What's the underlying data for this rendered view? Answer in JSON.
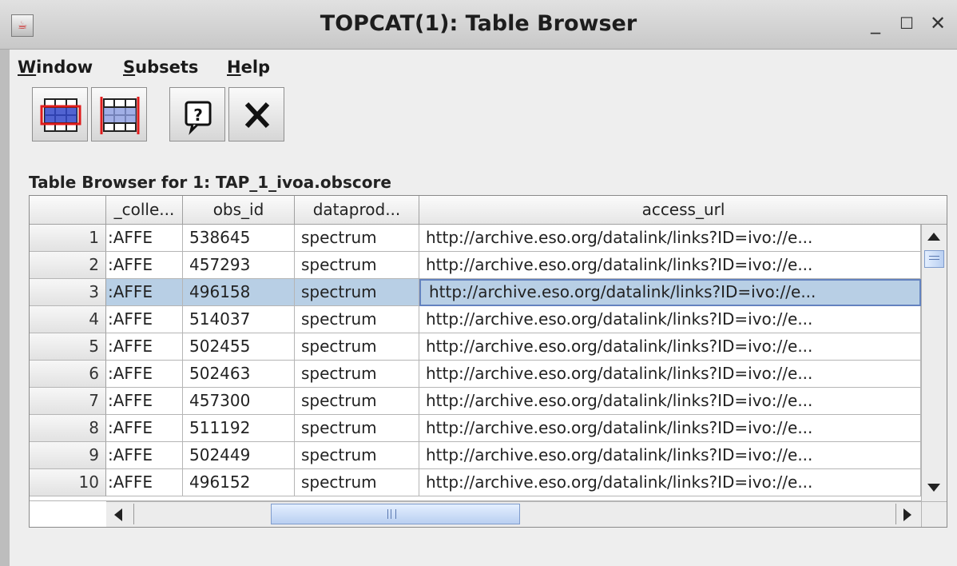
{
  "window": {
    "title": "TOPCAT(1): Table Browser"
  },
  "menubar": {
    "items": [
      {
        "label_pre": "",
        "label_key": "W",
        "label_post": "indow"
      },
      {
        "label_pre": "",
        "label_key": "S",
        "label_post": "ubsets"
      },
      {
        "label_pre": "",
        "label_key": "H",
        "label_post": "elp"
      }
    ]
  },
  "toolbar": {
    "icons": [
      "highlight-row-icon",
      "highlight-column-icon",
      "help-icon",
      "close-icon"
    ]
  },
  "browser": {
    "label": "Table Browser for 1: TAP_1_ivoa.obscore"
  },
  "table": {
    "columns": [
      "_colle...",
      "obs_id",
      "dataprod...",
      "access_url"
    ],
    "rows": [
      {
        "index": "1",
        "collection": ":AFFE",
        "obs_id": "538645",
        "dataproduct": "spectrum",
        "access_url": "http://archive.eso.org/datalink/links?ID=ivo://e..."
      },
      {
        "index": "2",
        "collection": ":AFFE",
        "obs_id": "457293",
        "dataproduct": "spectrum",
        "access_url": "http://archive.eso.org/datalink/links?ID=ivo://e..."
      },
      {
        "index": "3",
        "collection": ":AFFE",
        "obs_id": "496158",
        "dataproduct": "spectrum",
        "access_url": "http://archive.eso.org/datalink/links?ID=ivo://e..."
      },
      {
        "index": "4",
        "collection": ":AFFE",
        "obs_id": "514037",
        "dataproduct": "spectrum",
        "access_url": "http://archive.eso.org/datalink/links?ID=ivo://e..."
      },
      {
        "index": "5",
        "collection": ":AFFE",
        "obs_id": "502455",
        "dataproduct": "spectrum",
        "access_url": "http://archive.eso.org/datalink/links?ID=ivo://e..."
      },
      {
        "index": "6",
        "collection": ":AFFE",
        "obs_id": "502463",
        "dataproduct": "spectrum",
        "access_url": "http://archive.eso.org/datalink/links?ID=ivo://e..."
      },
      {
        "index": "7",
        "collection": ":AFFE",
        "obs_id": "457300",
        "dataproduct": "spectrum",
        "access_url": "http://archive.eso.org/datalink/links?ID=ivo://e..."
      },
      {
        "index": "8",
        "collection": ":AFFE",
        "obs_id": "511192",
        "dataproduct": "spectrum",
        "access_url": "http://archive.eso.org/datalink/links?ID=ivo://e..."
      },
      {
        "index": "9",
        "collection": ":AFFE",
        "obs_id": "502449",
        "dataproduct": "spectrum",
        "access_url": "http://archive.eso.org/datalink/links?ID=ivo://e..."
      },
      {
        "index": "10",
        "collection": ":AFFE",
        "obs_id": "496152",
        "dataproduct": "spectrum",
        "access_url": "http://archive.eso.org/datalink/links?ID=ivo://e..."
      }
    ],
    "selected_row": 3
  },
  "colors": {
    "selection": "#b8cfe5",
    "selection_border": "#6382bf",
    "scroll_thumb": "#b9cff1"
  }
}
